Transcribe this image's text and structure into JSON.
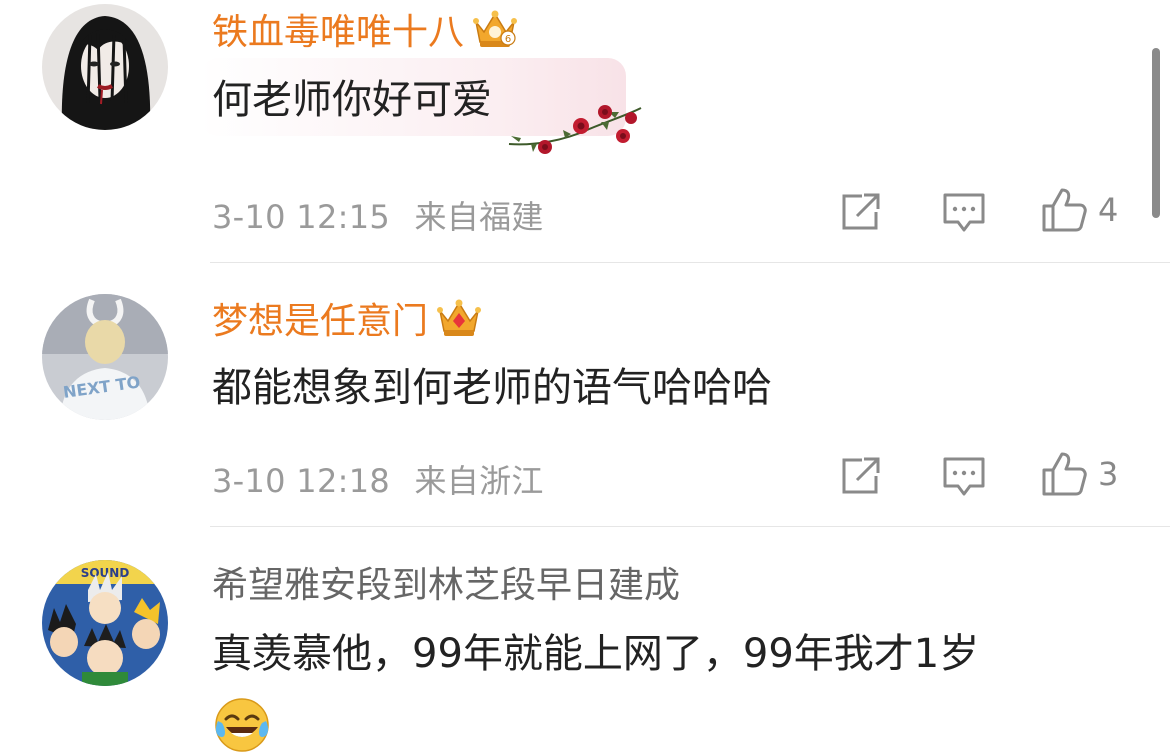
{
  "comments": [
    {
      "username": "铁血毒唯唯十八",
      "text": "何老师你好可爱",
      "time": "3-10 12:15",
      "location": "来自福建",
      "likes": "4"
    },
    {
      "username": "梦想是任意门",
      "text": "都能想象到何老师的语气哈哈哈",
      "time": "3-10 12:18",
      "location": "来自浙江",
      "likes": "3"
    },
    {
      "username": "希望雅安段到林芝段早日建成",
      "text": "真羡慕他，99年就能上网了，99年我才1岁"
    }
  ],
  "avatar_texts": {
    "next_to": "NEXT TO",
    "sound": "SOUND"
  },
  "icons": {
    "vip_badge": "crown-icon",
    "share": "share-icon",
    "reply": "comment-icon",
    "like": "thumbs-up-icon",
    "emoji": "laugh-cry-emoji"
  },
  "colors": {
    "vip_name": "#eb7a1f",
    "normal_name": "#666666",
    "meta": "#9a9a9a",
    "bubble_pink": "#f8e2e7"
  }
}
